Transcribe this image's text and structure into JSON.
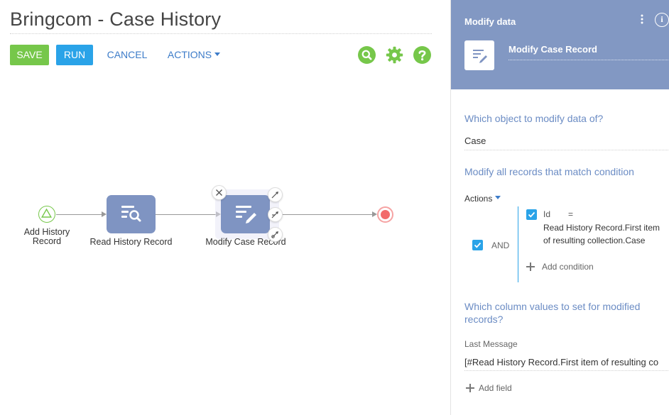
{
  "page": {
    "title": "Bringcom - Case History"
  },
  "toolbar": {
    "save_label": "SAVE",
    "run_label": "RUN",
    "cancel_label": "CANCEL",
    "actions_label": "ACTIONS"
  },
  "toolbar_icons": [
    "search-icon",
    "gear-icon",
    "help-icon"
  ],
  "diagram": {
    "start_label": "Add History Record",
    "read_label": "Read History Record",
    "modify_label": "Modify Case Record"
  },
  "panel": {
    "header_title": "Modify data",
    "info_glyph": "i",
    "element_name": "Modify Case Record",
    "object_question": "Which object to modify data of?",
    "object_value": "Case",
    "condition_question": "Modify all records that match condition",
    "actions_label": "Actions",
    "and_label": "AND",
    "condition_column": "Id",
    "condition_operator": "=",
    "condition_value_line1": "Read History Record.First item",
    "condition_value_line2": "of resulting collection.Case",
    "add_condition_label": "Add condition",
    "columns_question_line1": "Which column values to set for modified",
    "columns_question_line2": "records?",
    "field_label": "Last Message",
    "field_value": "[#Read History Record.First item of resulting co",
    "add_field_label": "Add field"
  },
  "colors": {
    "save_green": "#76c74a",
    "run_blue": "#2aa3e8",
    "link_blue": "#3d7cc9",
    "node_blue": "#7f94c2",
    "panel_header": "#8298c3",
    "question_blue": "#6b8cc4",
    "end_red": "#f26c6c"
  }
}
